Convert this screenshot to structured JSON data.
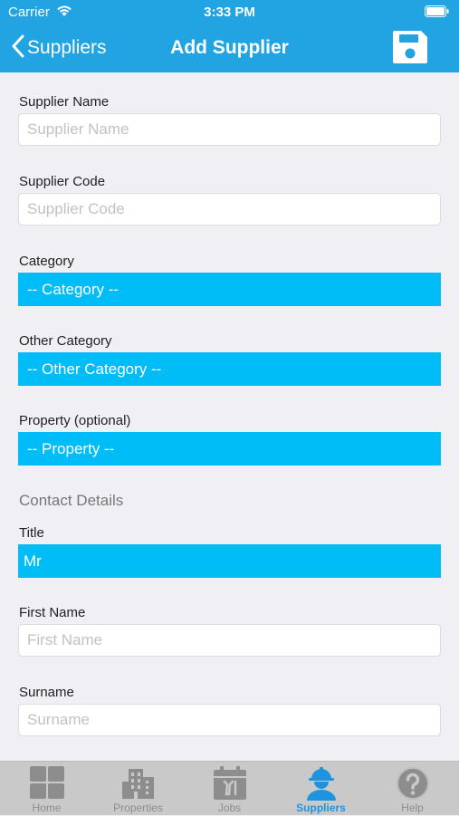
{
  "status_bar": {
    "carrier": "Carrier",
    "time": "3:33 PM"
  },
  "nav": {
    "back_label": "Suppliers",
    "title": "Add Supplier",
    "save_icon": "floppy-disk-icon"
  },
  "form": {
    "supplier_name": {
      "label": "Supplier Name",
      "placeholder": "Supplier Name",
      "value": ""
    },
    "supplier_code": {
      "label": "Supplier Code",
      "placeholder": "Supplier Code",
      "value": ""
    },
    "category": {
      "label": "Category",
      "value": "-- Category --"
    },
    "other_category": {
      "label": "Other Category",
      "value": "-- Other Category --"
    },
    "property": {
      "label": "Property (optional)",
      "value": "-- Property --"
    },
    "contact_section": "Contact Details",
    "title": {
      "label": "Title",
      "value": "Mr"
    },
    "first_name": {
      "label": "First Name",
      "placeholder": "First Name",
      "value": ""
    },
    "surname": {
      "label": "Surname",
      "placeholder": "Surname",
      "value": ""
    }
  },
  "tabs": [
    {
      "label": "Home",
      "icon": "grid-icon",
      "active": false
    },
    {
      "label": "Properties",
      "icon": "building-icon",
      "active": false
    },
    {
      "label": "Jobs",
      "icon": "calendar-tools-icon",
      "active": false
    },
    {
      "label": "Suppliers",
      "icon": "worker-icon",
      "active": true
    },
    {
      "label": "Help",
      "icon": "help-icon",
      "active": false
    }
  ],
  "colors": {
    "nav_background": "#22a4e2",
    "dropdown_background": "#00bdf7",
    "active_tab": "#1f93de",
    "inactive_tab": "#8d8d8d",
    "tab_bar_background": "#c9c9c9",
    "page_background": "#efeff4"
  }
}
